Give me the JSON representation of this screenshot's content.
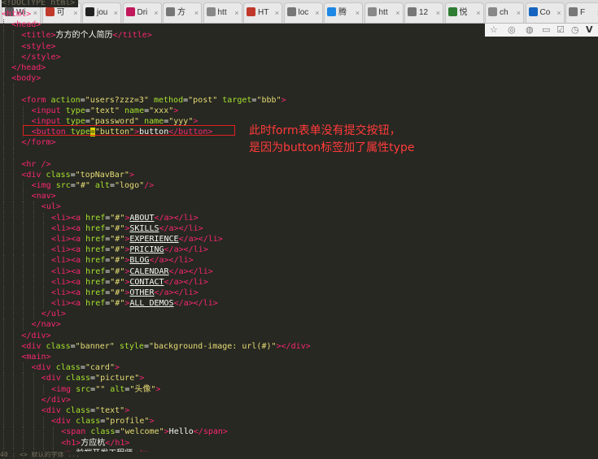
{
  "browser": {
    "tabs": [
      {
        "label": "Wi",
        "icon": "page-icon",
        "color": "#5a5a5a"
      },
      {
        "label": "可",
        "icon": "fox-icon",
        "color": "#c0392b"
      },
      {
        "label": "jou",
        "icon": "github-icon",
        "color": "#222222"
      },
      {
        "label": "Dri",
        "icon": "dribbble-icon",
        "color": "#c2185b"
      },
      {
        "label": "方",
        "icon": "page-icon",
        "color": "#777777"
      },
      {
        "label": "htt",
        "icon": "globe-icon",
        "color": "#888888"
      },
      {
        "label": "HT",
        "icon": "fox-icon",
        "color": "#c0392b"
      },
      {
        "label": "loc",
        "icon": "page-icon",
        "color": "#777777"
      },
      {
        "label": "腾",
        "icon": "tencent-icon",
        "color": "#1e88e5"
      },
      {
        "label": "htt",
        "icon": "globe-icon",
        "color": "#888888"
      },
      {
        "label": "12",
        "icon": "page-icon",
        "color": "#777777"
      },
      {
        "label": "悦",
        "icon": "grid-icon",
        "color": "#2e7d32"
      },
      {
        "label": "ch",
        "icon": "globe-icon",
        "color": "#888888"
      },
      {
        "label": "Co",
        "icon": "info-icon",
        "color": "#1565c0"
      },
      {
        "label": "F",
        "icon": "page-icon",
        "color": "#777777"
      }
    ],
    "toolbar_icons": [
      "star-icon",
      "extension-icon",
      "shield-icon",
      "mail-icon",
      "check-icon",
      "clock-icon",
      "vimeo-icon"
    ]
  },
  "editor": {
    "doctype": "<!DOCTYPE html>",
    "status_text": "40 : <> 默认的字体 ...",
    "lines": [
      {
        "indent": 0,
        "parts": [
          [
            "t",
            "<html>"
          ]
        ]
      },
      {
        "indent": 1,
        "parts": [
          [
            "t",
            "<head>"
          ]
        ]
      },
      {
        "indent": 2,
        "parts": [
          [
            "t",
            "<title>"
          ],
          [
            "p",
            "方方的个人简历"
          ],
          [
            "t",
            "</title>"
          ]
        ]
      },
      {
        "indent": 2,
        "parts": [
          [
            "t",
            "<style>"
          ]
        ]
      },
      {
        "indent": 2,
        "parts": [
          [
            "t",
            "</style>"
          ]
        ]
      },
      {
        "indent": 1,
        "parts": [
          [
            "t",
            "</head>"
          ]
        ]
      },
      {
        "indent": 1,
        "parts": [
          [
            "t",
            "<body>"
          ]
        ]
      },
      {
        "indent": 2,
        "parts": []
      },
      {
        "indent": 2,
        "parts": [
          [
            "t",
            "<form "
          ],
          [
            "a",
            "action"
          ],
          [
            "p",
            "="
          ],
          [
            "s",
            "\"users?zzz=3\""
          ],
          [
            "a",
            " method"
          ],
          [
            "p",
            "="
          ],
          [
            "s",
            "\"post\""
          ],
          [
            "a",
            " target"
          ],
          [
            "p",
            "="
          ],
          [
            "s",
            "\"bbb\""
          ],
          [
            "t",
            ">"
          ]
        ]
      },
      {
        "indent": 3,
        "parts": [
          [
            "t",
            "<input "
          ],
          [
            "a",
            "type"
          ],
          [
            "p",
            "="
          ],
          [
            "s",
            "\"text\""
          ],
          [
            "a",
            " name"
          ],
          [
            "p",
            "="
          ],
          [
            "s",
            "\"xxx\""
          ],
          [
            "t",
            ">"
          ]
        ]
      },
      {
        "indent": 3,
        "parts": [
          [
            "t",
            "<input "
          ],
          [
            "a",
            "type"
          ],
          [
            "p",
            "="
          ],
          [
            "s",
            "\"password\""
          ],
          [
            "a",
            " name"
          ],
          [
            "p",
            "="
          ],
          [
            "s",
            "\"yyy\""
          ],
          [
            "t",
            ">"
          ]
        ]
      },
      {
        "indent": 3,
        "parts": [
          [
            "t",
            "<button "
          ],
          [
            "a",
            "type"
          ],
          [
            "c",
            "="
          ],
          [
            "s",
            "\"button\""
          ],
          [
            "t",
            ">"
          ],
          [
            "p",
            "button"
          ],
          [
            "t",
            "</button>"
          ]
        ]
      },
      {
        "indent": 2,
        "parts": [
          [
            "t",
            "</form>"
          ]
        ]
      },
      {
        "indent": 2,
        "parts": []
      },
      {
        "indent": 2,
        "parts": [
          [
            "t",
            "<hr />"
          ]
        ]
      },
      {
        "indent": 2,
        "parts": [
          [
            "t",
            "<div "
          ],
          [
            "a",
            "class"
          ],
          [
            "p",
            "="
          ],
          [
            "s",
            "\"topNavBar\""
          ],
          [
            "t",
            ">"
          ]
        ]
      },
      {
        "indent": 3,
        "parts": [
          [
            "t",
            "<img "
          ],
          [
            "a",
            "src"
          ],
          [
            "p",
            "="
          ],
          [
            "s",
            "\"#\""
          ],
          [
            "a",
            " alt"
          ],
          [
            "p",
            "="
          ],
          [
            "s",
            "\"logo\""
          ],
          [
            "t",
            "/>"
          ]
        ]
      },
      {
        "indent": 3,
        "parts": [
          [
            "t",
            "<nav>"
          ]
        ]
      },
      {
        "indent": 4,
        "parts": [
          [
            "t",
            "<ul>"
          ]
        ]
      },
      {
        "indent": 5,
        "parts": [
          [
            "t",
            "<li><a "
          ],
          [
            "a",
            "href"
          ],
          [
            "p",
            "="
          ],
          [
            "s",
            "\"#\""
          ],
          [
            "t",
            ">"
          ],
          [
            "u",
            "ABOUT"
          ],
          [
            "t",
            "</a></li>"
          ]
        ]
      },
      {
        "indent": 5,
        "parts": [
          [
            "t",
            "<li><a "
          ],
          [
            "a",
            "href"
          ],
          [
            "p",
            "="
          ],
          [
            "s",
            "\"#\""
          ],
          [
            "t",
            ">"
          ],
          [
            "u",
            "SKILLS"
          ],
          [
            "t",
            "</a></li>"
          ]
        ]
      },
      {
        "indent": 5,
        "parts": [
          [
            "t",
            "<li><a "
          ],
          [
            "a",
            "href"
          ],
          [
            "p",
            "="
          ],
          [
            "s",
            "\"#\""
          ],
          [
            "t",
            ">"
          ],
          [
            "u",
            "EXPERIENCE"
          ],
          [
            "t",
            "</a></li>"
          ]
        ]
      },
      {
        "indent": 5,
        "parts": [
          [
            "t",
            "<li><a "
          ],
          [
            "a",
            "href"
          ],
          [
            "p",
            "="
          ],
          [
            "s",
            "\"#\""
          ],
          [
            "t",
            ">"
          ],
          [
            "u",
            "PRICING"
          ],
          [
            "t",
            "</a></li>"
          ]
        ]
      },
      {
        "indent": 5,
        "parts": [
          [
            "t",
            "<li><a "
          ],
          [
            "a",
            "href"
          ],
          [
            "p",
            "="
          ],
          [
            "s",
            "\"#\""
          ],
          [
            "t",
            ">"
          ],
          [
            "u",
            "BLOG"
          ],
          [
            "t",
            "</a></li>"
          ]
        ]
      },
      {
        "indent": 5,
        "parts": [
          [
            "t",
            "<li><a "
          ],
          [
            "a",
            "href"
          ],
          [
            "p",
            "="
          ],
          [
            "s",
            "\"#\""
          ],
          [
            "t",
            ">"
          ],
          [
            "u",
            "CALENDAR"
          ],
          [
            "t",
            "</a></li>"
          ]
        ]
      },
      {
        "indent": 5,
        "parts": [
          [
            "t",
            "<li><a "
          ],
          [
            "a",
            "href"
          ],
          [
            "p",
            "="
          ],
          [
            "s",
            "\"#\""
          ],
          [
            "t",
            ">"
          ],
          [
            "u",
            "CONTACT"
          ],
          [
            "t",
            "</a></li>"
          ]
        ]
      },
      {
        "indent": 5,
        "parts": [
          [
            "t",
            "<li><a "
          ],
          [
            "a",
            "href"
          ],
          [
            "p",
            "="
          ],
          [
            "s",
            "\"#\""
          ],
          [
            "t",
            ">"
          ],
          [
            "u",
            "OTHER"
          ],
          [
            "t",
            "</a></li>"
          ]
        ]
      },
      {
        "indent": 5,
        "parts": [
          [
            "t",
            "<li><a "
          ],
          [
            "a",
            "href"
          ],
          [
            "p",
            "="
          ],
          [
            "s",
            "\"#\""
          ],
          [
            "t",
            ">"
          ],
          [
            "u",
            "ALL DEMOS"
          ],
          [
            "t",
            "</a></li>"
          ]
        ]
      },
      {
        "indent": 4,
        "parts": [
          [
            "t",
            "</ul>"
          ]
        ]
      },
      {
        "indent": 3,
        "parts": [
          [
            "t",
            "</nav>"
          ]
        ]
      },
      {
        "indent": 2,
        "parts": [
          [
            "t",
            "</div>"
          ]
        ]
      },
      {
        "indent": 2,
        "parts": [
          [
            "t",
            "<div "
          ],
          [
            "a",
            "class"
          ],
          [
            "p",
            "="
          ],
          [
            "s",
            "\"banner\""
          ],
          [
            "a",
            " style"
          ],
          [
            "p",
            "="
          ],
          [
            "s",
            "\"background-image: url(#)\""
          ],
          [
            "t",
            "></div>"
          ]
        ]
      },
      {
        "indent": 2,
        "parts": [
          [
            "t",
            "<main>"
          ]
        ]
      },
      {
        "indent": 3,
        "parts": [
          [
            "t",
            "<div "
          ],
          [
            "a",
            "class"
          ],
          [
            "p",
            "="
          ],
          [
            "s",
            "\"card\""
          ],
          [
            "t",
            ">"
          ]
        ]
      },
      {
        "indent": 4,
        "parts": [
          [
            "t",
            "<div "
          ],
          [
            "a",
            "class"
          ],
          [
            "p",
            "="
          ],
          [
            "s",
            "\"picture\""
          ],
          [
            "t",
            ">"
          ]
        ]
      },
      {
        "indent": 5,
        "parts": [
          [
            "t",
            "<img "
          ],
          [
            "a",
            "src"
          ],
          [
            "p",
            "="
          ],
          [
            "s",
            "\"\""
          ],
          [
            "a",
            " alt"
          ],
          [
            "p",
            "="
          ],
          [
            "s",
            "\"头像\""
          ],
          [
            "t",
            ">"
          ]
        ]
      },
      {
        "indent": 4,
        "parts": [
          [
            "t",
            "</div>"
          ]
        ]
      },
      {
        "indent": 4,
        "parts": [
          [
            "t",
            "<div "
          ],
          [
            "a",
            "class"
          ],
          [
            "p",
            "="
          ],
          [
            "s",
            "\"text\""
          ],
          [
            "t",
            ">"
          ]
        ]
      },
      {
        "indent": 5,
        "parts": [
          [
            "t",
            "<div "
          ],
          [
            "a",
            "class"
          ],
          [
            "p",
            "="
          ],
          [
            "s",
            "\"profile\""
          ],
          [
            "t",
            ">"
          ]
        ]
      },
      {
        "indent": 6,
        "parts": [
          [
            "t",
            "<span "
          ],
          [
            "a",
            "class"
          ],
          [
            "p",
            "="
          ],
          [
            "s",
            "\"welcome\""
          ],
          [
            "t",
            ">"
          ],
          [
            "p",
            "Hello"
          ],
          [
            "t",
            "</span>"
          ]
        ]
      },
      {
        "indent": 6,
        "parts": [
          [
            "t",
            "<h1>"
          ],
          [
            "p",
            "方应杭"
          ],
          [
            "t",
            "</h1>"
          ]
        ]
      },
      {
        "indent": 6,
        "parts": [
          [
            "t",
            "<p>"
          ],
          [
            "p",
            "前端开发工程师"
          ],
          [
            "t",
            "</p>"
          ]
        ]
      }
    ]
  },
  "annotation": {
    "line1": "此时form表单没有提交按钮，",
    "line2": "是因为button标签加了属性type",
    "color": "#ff3a3a"
  }
}
